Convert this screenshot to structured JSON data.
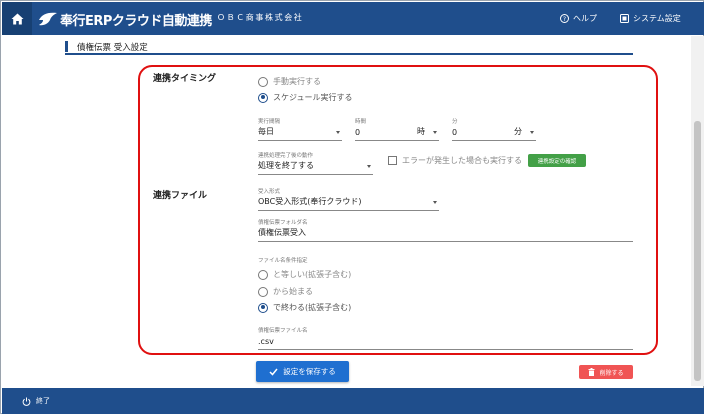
{
  "header": {
    "logo_text": "奉行ERPクラウド自動連携",
    "company": "ＯＢＣ商事株式会社",
    "help_label": "ヘルプ",
    "system_label": "システム設定"
  },
  "section_title": "債権伝票 受入設定",
  "timing": {
    "heading": "連携タイミング",
    "options": [
      "手動実行する",
      "スケジュール実行する"
    ],
    "interval_label": "実行間隔",
    "interval_value": "毎日",
    "hour_label": "時間",
    "hour_value": "0",
    "hour_unit": "時",
    "minute_label": "分",
    "minute_value": "0",
    "minute_unit": "分",
    "after_label": "連携処理完了後の動作",
    "after_value": "処理を終了する",
    "error_checkbox": "エラーが発生した場合も実行する",
    "confirm_button": "連携設定の確認"
  },
  "file": {
    "heading": "連携ファイル",
    "format_label": "受入形式",
    "format_value": "OBC受入形式(奉行クラウド)",
    "folder_label": "債権伝票フォルダ名",
    "folder_value": "債権伝票受入",
    "cond_label": "ファイル名条件指定",
    "cond_options": [
      "と等しい(拡張子含む)",
      "から始まる",
      "で終わる(拡張子含む)"
    ],
    "filename_label": "債権伝票ファイル名",
    "filename_value": ".csv"
  },
  "actions": {
    "save": "設定を保存する",
    "delete": "削除する"
  },
  "footer": {
    "exit": "終了"
  },
  "colors": {
    "header_bg": "#1f4e8c",
    "highlight": "#e01010",
    "save_button": "#1f6fd0",
    "delete_button": "#f05454",
    "confirm_button": "#43a047"
  }
}
